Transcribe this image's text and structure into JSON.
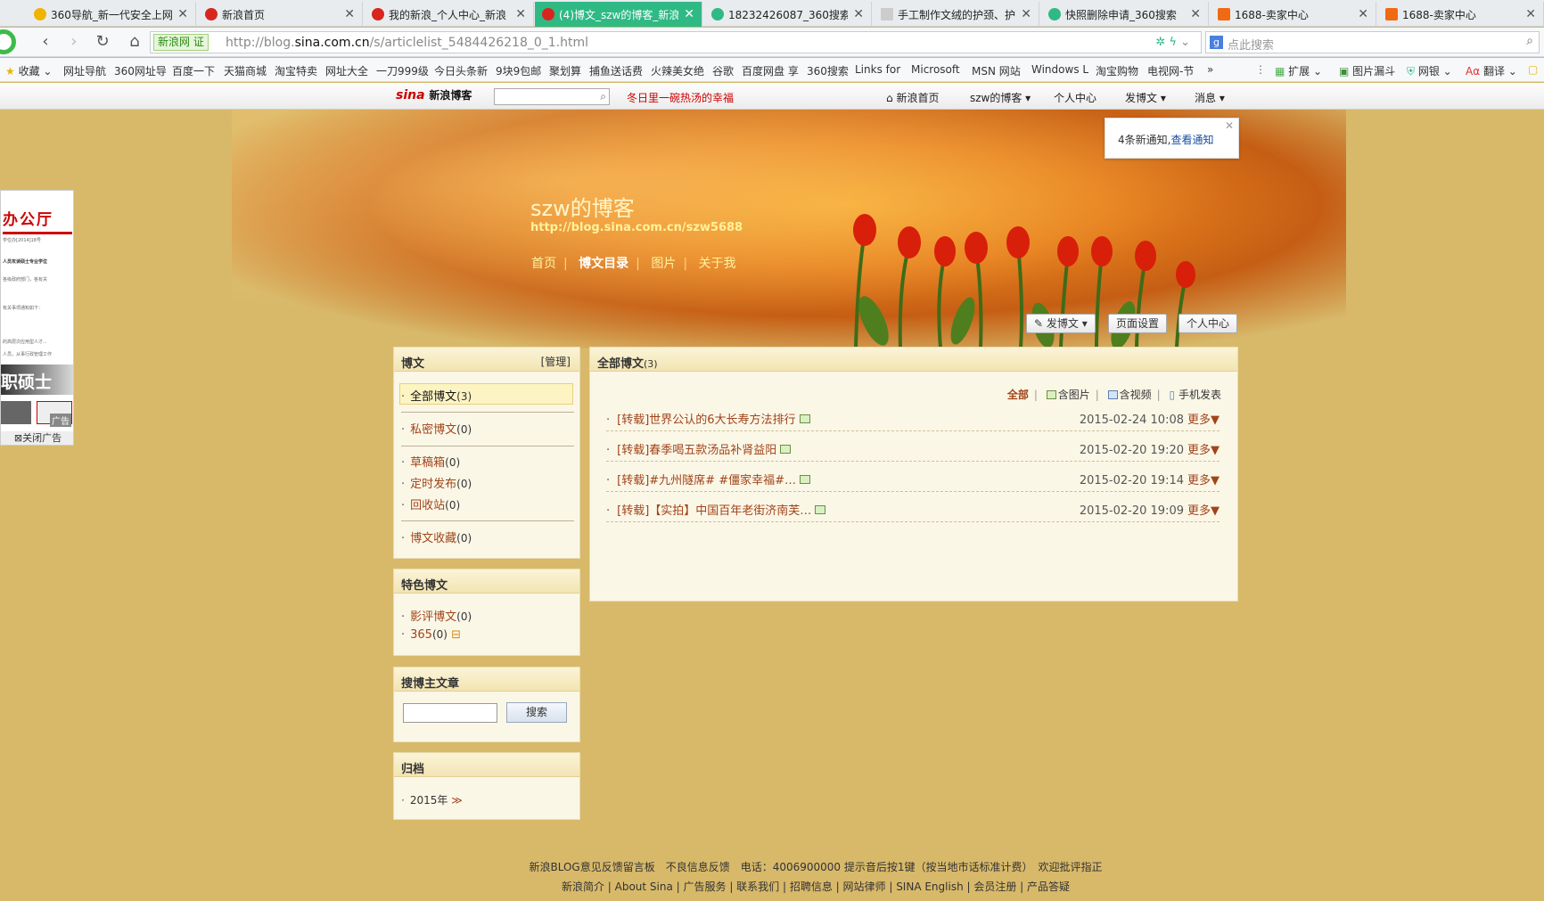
{
  "browser": {
    "tabs": [
      {
        "title": "360导航_新一代安全上网",
        "color": "#f0b400"
      },
      {
        "title": "新浪首页",
        "color": "#d8261f"
      },
      {
        "title": "我的新浪_个人中心_新浪",
        "color": "#d8261f"
      },
      {
        "title": "(4)博文_szw的博客_新浪",
        "color": "#d8261f"
      },
      {
        "title": "18232426087_360搜索",
        "color": "#2fb985"
      },
      {
        "title": "手工制作文绒的护颈、护",
        "color": "#cccccc"
      },
      {
        "title": "快照删除申请_360搜索",
        "color": "#2fb985"
      },
      {
        "title": "1688-卖家中心",
        "color": "#f06a13"
      },
      {
        "title": "1688-卖家中心",
        "color": "#f06a13"
      }
    ],
    "site_badge": "新浪网 证",
    "url_prefix": "http://blog.",
    "url_domain": "sina.com.cn",
    "url_path": "/s/articlelist_5484426218_0_1.html",
    "search_placeholder": "点此搜索",
    "bookmarks": [
      "收藏",
      "网址导航",
      "360网址导",
      "百度一下",
      "天猫商城",
      "淘宝特卖",
      "网址大全",
      "一刀999级",
      "今日头条新",
      "9块9包邮",
      "聚划算",
      "捕鱼送话费",
      "火辣美女绝",
      "谷歌",
      "百度网盘 享",
      "360搜索",
      "Links for",
      "Microsoft",
      "MSN 网站",
      "Windows L",
      "淘宝购物",
      "电视网-节",
      "»"
    ],
    "ext_items": [
      "扩展",
      "图片漏斗",
      "网银",
      "翻译"
    ]
  },
  "sina_bar": {
    "logo": "sina",
    "logo_text": "新浪博客",
    "slogan": "冬日里一碗热汤的幸福",
    "links": [
      "新浪首页",
      "szw的博客 ▾",
      "个人中心",
      "发博文 ▾",
      "消息 ▾"
    ]
  },
  "notice": {
    "text": "4条新通知,",
    "link": "查看通知",
    "close": "✕"
  },
  "blog": {
    "title": "szw的博客",
    "url": "http://blog.sina.com.cn/szw5688",
    "nav": [
      "首页",
      "博文目录",
      "图片",
      "关于我"
    ],
    "actions": [
      "发博文 ▾",
      "页面设置",
      "个人中心"
    ]
  },
  "sidebar": {
    "posts_panel": {
      "title": "博文",
      "manage": "[管理]",
      "items": [
        {
          "label": "全部博文",
          "count": "(3)"
        },
        {
          "label": "私密博文",
          "count": "(0)"
        },
        {
          "label": "草稿箱",
          "count": "(0)"
        },
        {
          "label": "定时发布",
          "count": "(0)"
        },
        {
          "label": "回收站",
          "count": "(0)"
        },
        {
          "label": "博文收藏",
          "count": "(0)"
        }
      ]
    },
    "featured_panel": {
      "title": "特色博文",
      "items": [
        {
          "label": "影评博文",
          "count": "(0)"
        },
        {
          "label": "365",
          "count": "(0)"
        }
      ]
    },
    "search_panel": {
      "title": "搜博主文章",
      "button": "搜索"
    },
    "archive_panel": {
      "title": "归档",
      "year": "2015年",
      "toggle": "≫"
    }
  },
  "main": {
    "title": "全部博文",
    "count": "(3)",
    "filters": [
      "全部",
      "含图片",
      "含视频",
      "手机发表"
    ],
    "articles": [
      {
        "title": "[转载]世界公认的6大长寿方法排行",
        "date": "2015-02-24 10:08",
        "more": "更多▼"
      },
      {
        "title": "[转载]春季喝五款汤品补肾益阳",
        "date": "2015-02-20 19:20",
        "more": "更多▼"
      },
      {
        "title": "[转载]#九州隧席# #僵家幸福#…",
        "date": "2015-02-20 19:14",
        "more": "更多▼"
      },
      {
        "title": "[转载]【实拍】中国百年老街济南芙…",
        "date": "2015-02-20 19:09",
        "more": "更多▼"
      }
    ]
  },
  "ad": {
    "heading": "办公厅",
    "band": "职硕士",
    "tag": "广告",
    "close": "关闭广告",
    "lines": [
      "学位办[2014]18号",
      "人员攻读硕士专业学位",
      "各级政府部门，各有关",
      "有关事项通知如下：",
      "的高层次应用型人才...",
      "人员，从事行政管理工作"
    ]
  },
  "footer": {
    "line1": "新浪BLOG意见反馈留言板　不良信息反馈　电话：4006900000 提示音后按1键（按当地市话标准计费）　欢迎批评指正",
    "line2": "新浪简介 | About Sina | 广告服务 | 联系我们 | 招聘信息 | 网站律师 | SINA English | 会员注册 | 产品答疑"
  }
}
